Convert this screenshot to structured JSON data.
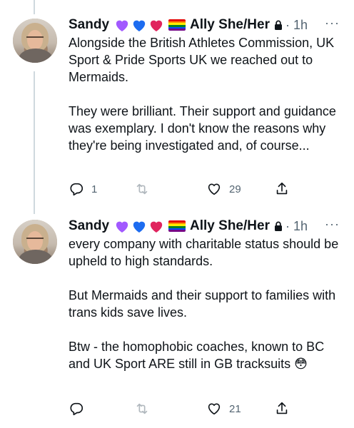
{
  "tweets": [
    {
      "display_name": "Sandy",
      "pronoun_label": "Ally She/Her",
      "time": "· 1h",
      "more": "···",
      "paragraphs": [
        "Alongside the British Athletes Commission, UK Sport & Pride Sports UK we reached out to Mermaids.",
        "They were brilliant.  Their support and guidance was exemplary.   I don't know the reasons why they're being investigated and, of course..."
      ],
      "replies": "1",
      "retweets": "",
      "likes": "29"
    },
    {
      "display_name": "Sandy",
      "pronoun_label": "Ally She/Her",
      "time": "· 1h",
      "more": "···",
      "paragraphs": [
        "every company with charitable status should be upheld to high standards.",
        "But Mermaids and their support to families with trans kids save lives.",
        "Btw - the homophobic coaches, known to BC and UK Sport ARE still in GB tracksuits 😳"
      ],
      "replies": "",
      "retweets": "",
      "likes": "21"
    }
  ],
  "colors": {
    "text": "#0f1419",
    "muted": "#536471",
    "thread_line": "#cfd9de",
    "heart_purple": "#a259ff",
    "heart_blue": "#1d6cf0",
    "heart_red": "#e0245e"
  },
  "icons": [
    "reply-icon",
    "retweet-icon",
    "like-icon",
    "share-icon",
    "lock-icon",
    "more-icon",
    "pride-flag-icon"
  ]
}
